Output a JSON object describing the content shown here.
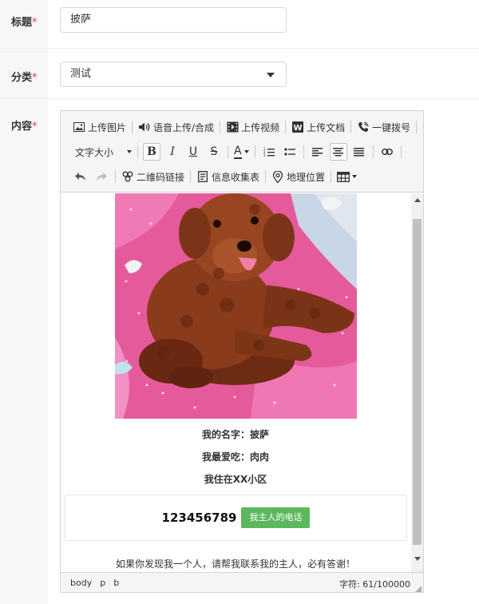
{
  "form": {
    "title": {
      "label": "标题",
      "value": "披萨"
    },
    "category": {
      "label": "分类",
      "value": "测试"
    },
    "content": {
      "label": "内容"
    },
    "required_mark": "*"
  },
  "toolbar": {
    "upload_image": "上传图片",
    "voice": "语音上传/合成",
    "upload_video": "上传视频",
    "upload_doc": "上传文档",
    "dial": "一键拨号",
    "font_size": "文字大小",
    "bold": "B",
    "italic": "I",
    "underline": "U",
    "strike": "S",
    "font_color": "A",
    "qrcode": "二维码链接",
    "form_collect": "信息收集表",
    "location": "地理位置"
  },
  "content": {
    "photo_icon": "dog-photo",
    "name_line": "我的名字：披萨",
    "food_line": "我最爱吃：肉肉",
    "home_line": "我住在XX小区",
    "phone_number": "123456789",
    "phone_button": "我主人的电话",
    "thanks_line": "如果你发现我一个人，请帮我联系我的主人，必有答谢！"
  },
  "statusbar": {
    "path": [
      "body",
      "p",
      "b"
    ],
    "char_count": "字符: 61/100000"
  },
  "colors": {
    "accent_green": "#5cb85c",
    "required_red": "#e4393c"
  }
}
